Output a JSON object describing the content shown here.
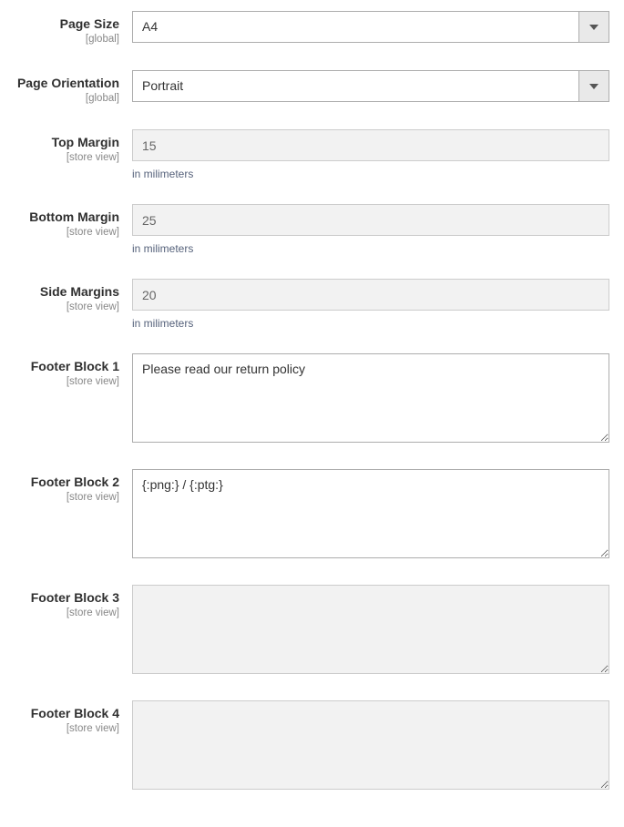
{
  "fields": {
    "pageSize": {
      "label": "Page Size",
      "scope": "[global]",
      "value": "A4"
    },
    "pageOrientation": {
      "label": "Page Orientation",
      "scope": "[global]",
      "value": "Portrait"
    },
    "topMargin": {
      "label": "Top Margin",
      "scope": "[store view]",
      "value": "15",
      "hint": "in milimeters"
    },
    "bottomMargin": {
      "label": "Bottom Margin",
      "scope": "[store view]",
      "value": "25",
      "hint": "in milimeters"
    },
    "sideMargins": {
      "label": "Side Margins",
      "scope": "[store view]",
      "value": "20",
      "hint": "in milimeters"
    },
    "footerBlock1": {
      "label": "Footer Block 1",
      "scope": "[store view]",
      "value": "Please read our return policy"
    },
    "footerBlock2": {
      "label": "Footer Block 2",
      "scope": "[store view]",
      "value": "{:png:} / {:ptg:}"
    },
    "footerBlock3": {
      "label": "Footer Block 3",
      "scope": "[store view]",
      "value": ""
    },
    "footerBlock4": {
      "label": "Footer Block 4",
      "scope": "[store view]",
      "value": ""
    }
  }
}
